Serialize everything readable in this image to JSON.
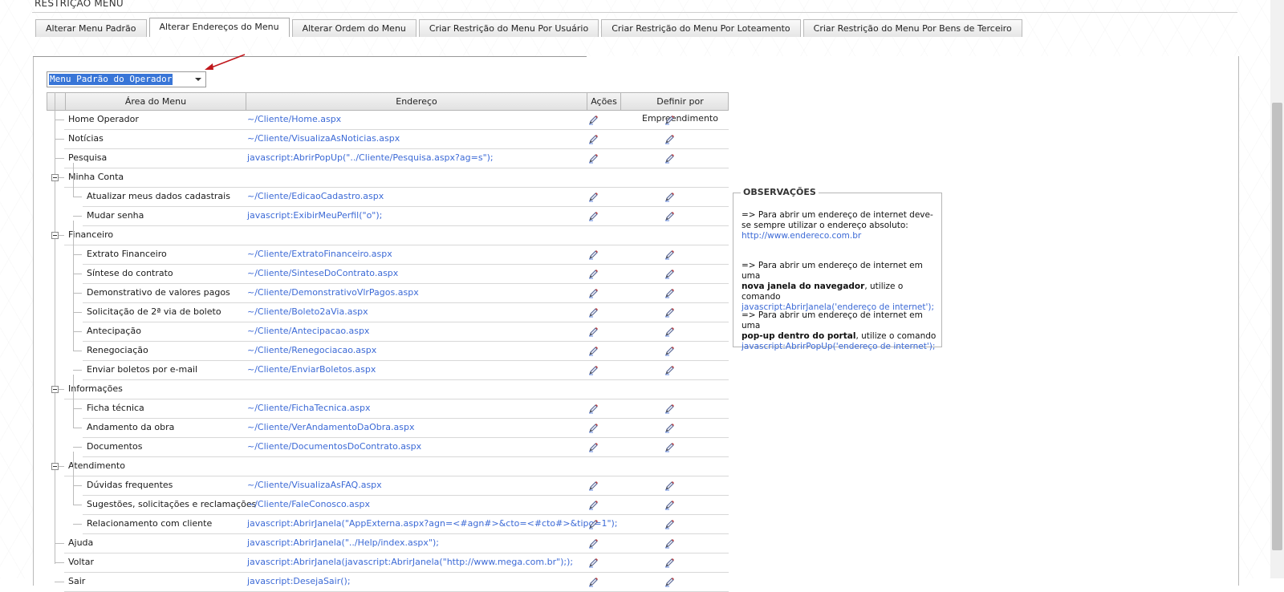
{
  "page": {
    "title": "RESTRIÇÃO MENU"
  },
  "tabs": [
    {
      "label": "Alterar Menu Padrão",
      "active": false
    },
    {
      "label": "Alterar Endereços do Menu",
      "active": true
    },
    {
      "label": "Alterar Ordem do Menu",
      "active": false
    },
    {
      "label": "Criar Restrição do Menu Por Usuário",
      "active": false
    },
    {
      "label": "Criar Restrição do Menu Por Loteamento",
      "active": false
    },
    {
      "label": "Criar Restrição do Menu Por Bens de Terceiro",
      "active": false
    }
  ],
  "menu_select": {
    "value": "Menu Padrão do Operador"
  },
  "grid": {
    "headers": [
      "Área do Menu",
      "Endereço",
      "Ações",
      "Definir por Empreendimento"
    ],
    "rows": [
      {
        "label": "Home Operador",
        "address": "~/Cliente/Home.aspx",
        "level": 0,
        "group": false,
        "actions": true
      },
      {
        "label": "Notícias",
        "address": "~/Cliente/VisualizaAsNoticias.aspx",
        "level": 0,
        "group": false,
        "actions": true
      },
      {
        "label": "Pesquisa",
        "address": "javascript:AbrirPopUp(\"../Cliente/Pesquisa.aspx?ag=s\");",
        "level": 0,
        "group": false,
        "actions": true
      },
      {
        "label": "Minha Conta",
        "address": "",
        "level": 0,
        "group": true,
        "actions": false
      },
      {
        "label": "Atualizar meus dados cadastrais",
        "address": "~/Cliente/EdicaoCadastro.aspx",
        "level": 1,
        "group": false,
        "actions": true
      },
      {
        "label": "Mudar senha",
        "address": "javascript:ExibirMeuPerfil(\"o\");",
        "level": 1,
        "group": false,
        "actions": true
      },
      {
        "label": "Financeiro",
        "address": "",
        "level": 0,
        "group": true,
        "actions": false
      },
      {
        "label": "Extrato Financeiro",
        "address": "~/Cliente/ExtratoFinanceiro.aspx",
        "level": 1,
        "group": false,
        "actions": true
      },
      {
        "label": "Síntese do contrato",
        "address": "~/Cliente/SinteseDoContrato.aspx",
        "level": 1,
        "group": false,
        "actions": true
      },
      {
        "label": "Demonstrativo de valores pagos",
        "address": "~/Cliente/DemonstrativoVlrPagos.aspx",
        "level": 1,
        "group": false,
        "actions": true
      },
      {
        "label": "Solicitação de 2ª via de boleto",
        "address": "~/Cliente/Boleto2aVia.aspx",
        "level": 1,
        "group": false,
        "actions": true
      },
      {
        "label": "Antecipação",
        "address": "~/Cliente/Antecipacao.aspx",
        "level": 1,
        "group": false,
        "actions": true
      },
      {
        "label": "Renegociação",
        "address": "~/Cliente/Renegociacao.aspx",
        "level": 1,
        "group": false,
        "actions": true
      },
      {
        "label": "Enviar boletos por e-mail",
        "address": "~/Cliente/EnviarBoletos.aspx",
        "level": 1,
        "group": false,
        "actions": true
      },
      {
        "label": "Informações",
        "address": "",
        "level": 0,
        "group": true,
        "actions": false
      },
      {
        "label": "Ficha técnica",
        "address": "~/Cliente/FichaTecnica.aspx",
        "level": 1,
        "group": false,
        "actions": true
      },
      {
        "label": "Andamento da obra",
        "address": "~/Cliente/VerAndamentoDaObra.aspx",
        "level": 1,
        "group": false,
        "actions": true
      },
      {
        "label": "Documentos",
        "address": "~/Cliente/DocumentosDoContrato.aspx",
        "level": 1,
        "group": false,
        "actions": true
      },
      {
        "label": "Atendimento",
        "address": "",
        "level": 0,
        "group": true,
        "actions": false
      },
      {
        "label": "Dúvidas frequentes",
        "address": "~/Cliente/VisualizaAsFAQ.aspx",
        "level": 1,
        "group": false,
        "actions": true
      },
      {
        "label": "Sugestões, solicitações e reclamações",
        "address": "~/Cliente/FaleConosco.aspx",
        "level": 1,
        "group": false,
        "actions": true
      },
      {
        "label": "Relacionamento com cliente",
        "address": "javascript:AbrirJanela(\"AppExterna.aspx?agn=<#agn#>&cto=<#cto#>&tipo=1\");",
        "level": 1,
        "group": false,
        "actions": true
      },
      {
        "label": "Ajuda",
        "address": "javascript:AbrirJanela(\"../Help/index.aspx\");",
        "level": 0,
        "group": false,
        "actions": true
      },
      {
        "label": "Voltar",
        "address": "javascript:AbrirJanela(javascript:AbrirJanela(\"http://www.mega.com.br\"););",
        "level": 0,
        "group": false,
        "actions": true
      },
      {
        "label": "Sair",
        "address": "javascript:DesejaSair();",
        "level": 0,
        "group": false,
        "actions": true
      }
    ]
  },
  "observations": {
    "title": "OBSERVAÇÕES",
    "note1_text": "=> Para abrir um endereço de internet deve-se sempre utilizar o endereço absoluto:",
    "note1_link": "http://www.endereco.com.br",
    "note2_prefix": "=> Para abrir um endereço de internet em uma",
    "note2_bold": "nova janela do navegador",
    "note2_suffix": ", utilize o comando",
    "note2_code": "javascript:AbrirJanela('endereço de internet');",
    "note3_prefix": "=> Para abrir um endereço de internet em uma",
    "note3_bold": "pop-up dentro do portal",
    "note3_suffix": ", utilize o comando",
    "note3_code": "javascript:AbrirPopUp('endereço de internet');"
  },
  "icons": {
    "edit": "pencil-icon",
    "collapse": "minus-box-icon",
    "arrow": "red-arrow"
  },
  "colors": {
    "link": "#3c6ad6",
    "selection": "#3875d7",
    "arrow": "#c0171c"
  }
}
